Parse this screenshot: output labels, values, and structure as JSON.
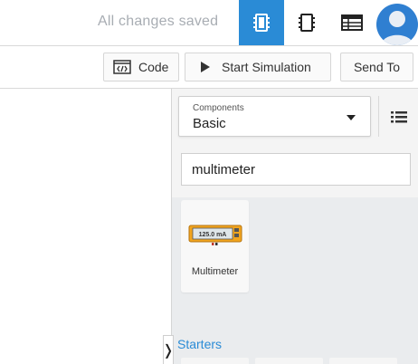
{
  "header": {
    "status": "All changes saved",
    "icons": [
      "circuit-view-icon",
      "schematic-view-icon",
      "component-list-icon"
    ],
    "active_color": "#2a8bd6"
  },
  "toolbar": {
    "code_label": "Code",
    "simulate_label": "Start Simulation",
    "send_label": "Send To"
  },
  "panel": {
    "select_caption": "Components",
    "select_value": "Basic",
    "search_value": "multimeter",
    "component": {
      "name": "Multimeter",
      "display": "125.0 mA"
    },
    "section_title": "Starters"
  }
}
